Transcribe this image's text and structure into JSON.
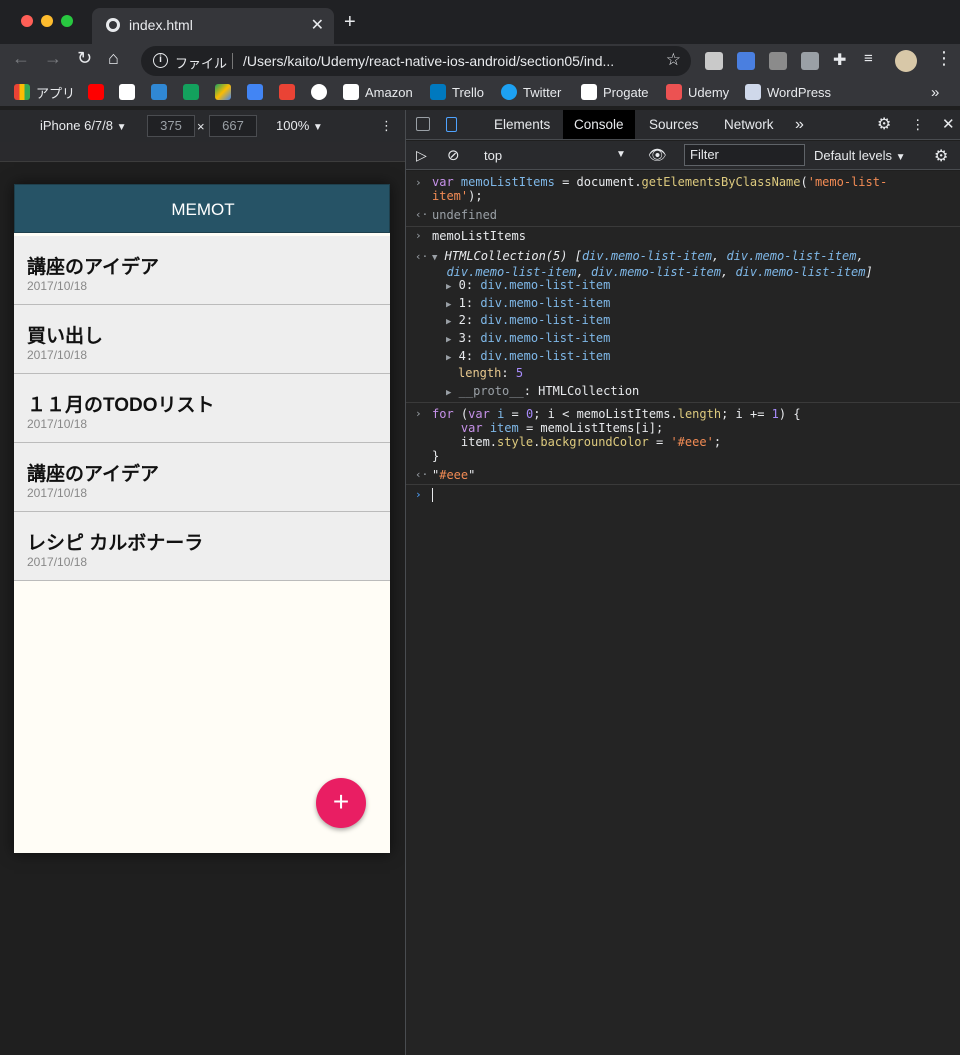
{
  "browser": {
    "tab_title": "index.html",
    "tab_close": "✕",
    "new_tab": "+",
    "omnibox_scheme": "ファイル",
    "omnibox_url": "/Users/kaito/Udemy/react-native-ios-android/section05/ind...",
    "bookmarks": [
      {
        "label": "アプリ",
        "color": "#e8eaed"
      },
      {
        "label": "",
        "color": "#ff0000"
      },
      {
        "label": "",
        "color": "#ffffff"
      },
      {
        "label": "",
        "color": "#3088d4"
      },
      {
        "label": "",
        "color": "#13a15d"
      },
      {
        "label": "",
        "color": "#1aa260"
      },
      {
        "label": "",
        "color": "#4285f4"
      },
      {
        "label": "",
        "color": "#ea4335"
      },
      {
        "label": "",
        "color": "#ffffff"
      },
      {
        "label": "Amazon",
        "color": "#ffffff"
      },
      {
        "label": "Trello",
        "color": "#0079bf"
      },
      {
        "label": "Twitter",
        "color": "#1da1f2"
      },
      {
        "label": "Progate",
        "color": "#ffffff"
      },
      {
        "label": "Udemy",
        "color": "#ec5252"
      },
      {
        "label": "WordPress",
        "color": "#cfd8ea"
      }
    ],
    "bookmarks_overflow": "»"
  },
  "device_toolbar": {
    "device": "iPhone 6/7/8",
    "width": "375",
    "times": "×",
    "height": "667",
    "zoom": "100%"
  },
  "app": {
    "header_title": "MEMOT",
    "memos": [
      {
        "title": "講座のアイデア",
        "date": "2017/10/18"
      },
      {
        "title": "買い出し",
        "date": "2017/10/18"
      },
      {
        "title": "１１月のTODOリスト",
        "date": "2017/10/18"
      },
      {
        "title": "講座のアイデア",
        "date": "2017/10/18"
      },
      {
        "title": "レシピ カルボナーラ",
        "date": "2017/10/18"
      }
    ],
    "fab_label": "+",
    "header_color": "#265366",
    "fab_color": "#e91e63"
  },
  "devtools": {
    "tabs": [
      "Elements",
      "Console",
      "Sources",
      "Network"
    ],
    "active_tab": "Console",
    "more_tabs": "»",
    "context": "top",
    "filter_placeholder": "Filter",
    "levels": "Default levels"
  }
}
